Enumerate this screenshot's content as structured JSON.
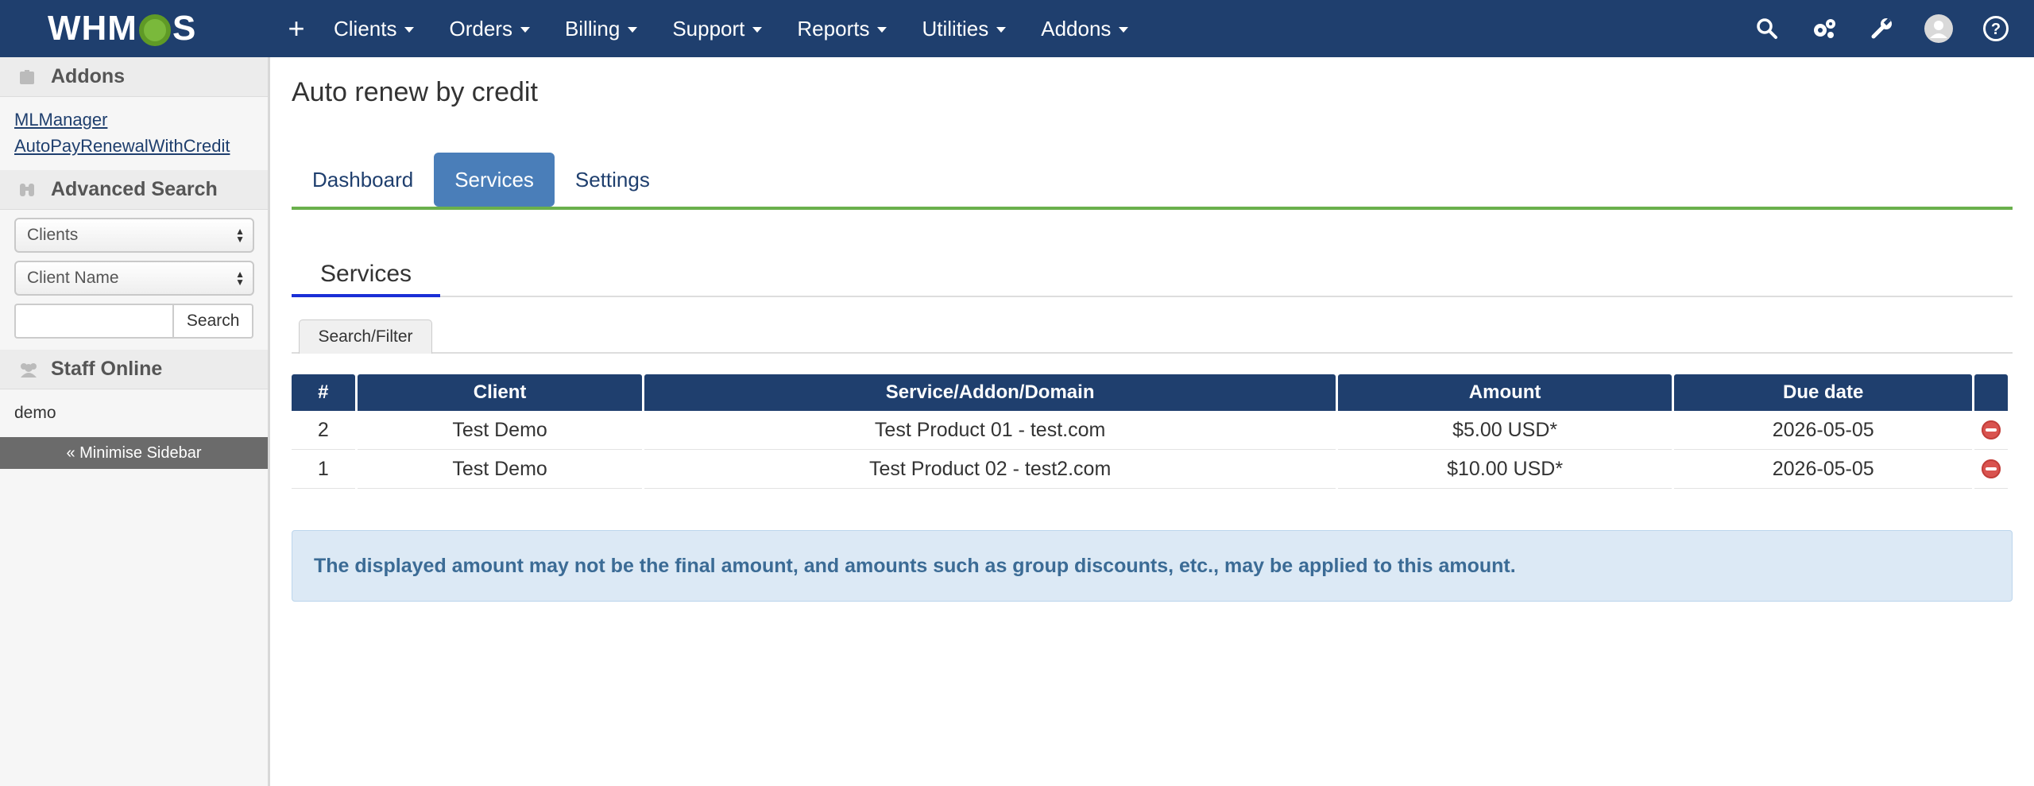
{
  "brand": {
    "logo_text_left": "WHM",
    "logo_text_right": "S",
    "accent": "#7ab93b"
  },
  "topnav": {
    "add_label": "+",
    "items": [
      {
        "label": "Clients"
      },
      {
        "label": "Orders"
      },
      {
        "label": "Billing"
      },
      {
        "label": "Support"
      },
      {
        "label": "Reports"
      },
      {
        "label": "Utilities"
      },
      {
        "label": "Addons"
      }
    ],
    "right_icons": [
      "search-icon",
      "gears-icon",
      "wrench-icon",
      "avatar-icon",
      "help-icon"
    ]
  },
  "sidebar": {
    "addons": {
      "title": "Addons",
      "links": [
        "MLManager",
        "AutoPayRenewalWithCredit"
      ]
    },
    "advanced_search": {
      "title": "Advanced Search",
      "type_select": "Clients",
      "field_select": "Client Name",
      "search_button": "Search",
      "search_value": ""
    },
    "staff_online": {
      "title": "Staff Online",
      "users": [
        "demo"
      ]
    },
    "minimise_label": "« Minimise Sidebar"
  },
  "main": {
    "title": "Auto renew by credit",
    "tabs": [
      {
        "label": "Dashboard",
        "active": false
      },
      {
        "label": "Services",
        "active": true
      },
      {
        "label": "Settings",
        "active": false
      }
    ],
    "subtab": "Services",
    "filter_button": "Search/Filter",
    "table": {
      "headers": [
        "#",
        "Client",
        "Service/Addon/Domain",
        "Amount",
        "Due date",
        ""
      ],
      "rows": [
        {
          "id": "2",
          "client": "Test Demo",
          "service": "Test Product 01 - test.com",
          "amount": "$5.00 USD*",
          "due": "2026-05-05"
        },
        {
          "id": "1",
          "client": "Test Demo",
          "service": "Test Product 02 - test2.com",
          "amount": "$10.00 USD*",
          "due": "2026-05-05"
        }
      ]
    },
    "notice": "The displayed amount may not be the final amount, and amounts such as group discounts, etc., may be applied to this amount."
  }
}
